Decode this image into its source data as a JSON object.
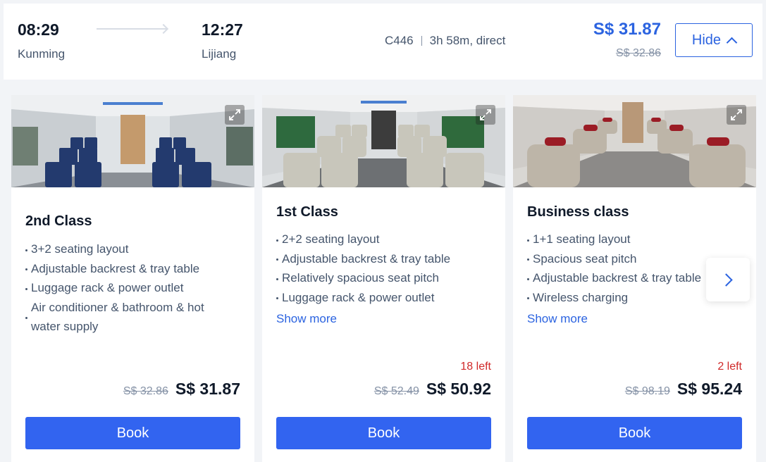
{
  "header": {
    "departure_time": "08:29",
    "departure_city": "Kunming",
    "arrival_time": "12:27",
    "arrival_city": "Lijiang",
    "train_number": "C446",
    "duration": "3h 58m, direct",
    "price": "S$ 31.87",
    "original_price": "S$ 32.86",
    "hide_label": "Hide"
  },
  "seats": [
    {
      "title": "2nd Class",
      "features": [
        "3+2 seating layout",
        "Adjustable backrest & tray table",
        "Luggage rack & power outlet",
        "Air conditioner & bathroom & hot water supply"
      ],
      "show_more": "",
      "left": "",
      "original_price": "S$ 32.86",
      "price": "S$ 31.87",
      "book_label": "Book"
    },
    {
      "title": "1st Class",
      "features": [
        "2+2 seating layout",
        "Adjustable backrest & tray table",
        "Relatively spacious seat pitch",
        "Luggage rack & power outlet"
      ],
      "show_more": "Show more",
      "left": "18 left",
      "original_price": "S$ 52.49",
      "price": "S$ 50.92",
      "book_label": "Book"
    },
    {
      "title": "Business class",
      "features": [
        "1+1 seating layout",
        "Spacious seat pitch",
        "Adjustable backrest & tray table",
        "Wireless charging"
      ],
      "show_more": "Show more",
      "left": "2 left",
      "original_price": "S$ 98.19",
      "price": "S$ 95.24",
      "book_label": "Book"
    }
  ],
  "colors": {
    "accent": "#2b63e0",
    "book_button": "#3264f0",
    "alert": "#d02a2a",
    "muted": "#8592a6"
  },
  "icons": {
    "expand": "expand-icon",
    "next": "chevron-right-icon",
    "hide": "chevron-up-icon"
  }
}
